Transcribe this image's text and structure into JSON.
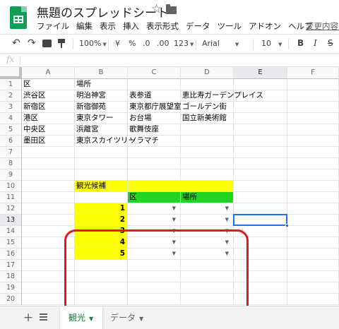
{
  "app": {
    "title": "無題のスプレッドシート",
    "star_icon": "star-icon",
    "folder_icon": "folder-icon",
    "last_edit": "変更内容を"
  },
  "menu": [
    "ファイル",
    "編集",
    "表示",
    "挿入",
    "表示形式",
    "データ",
    "ツール",
    "アドオン",
    "ヘルプ"
  ],
  "toolbar": {
    "zoom": "100%",
    "currency": "¥",
    "percent": "%",
    "decimal_decrease": ".0",
    "decimal_increase": ".00",
    "more_formats": "123",
    "font": "Arial",
    "font_size": "10",
    "bold": "B",
    "italic": "I",
    "strikethrough": "S"
  },
  "formula_bar": {
    "label": "fx"
  },
  "columns": [
    "A",
    "B",
    "C",
    "D",
    "E",
    "F"
  ],
  "rows": [
    "1",
    "2",
    "3",
    "4",
    "5",
    "6",
    "7",
    "8",
    "9",
    "10",
    "11",
    "12",
    "13",
    "14",
    "15",
    "16",
    "17",
    "18",
    "19",
    "20"
  ],
  "cells": {
    "A1": "区",
    "B1": "場所",
    "A2": "渋谷区",
    "B2": "明治神宮",
    "C2": "表参道",
    "D2": "恵比寿ガーデンプレイス",
    "A3": "新宿区",
    "B3": "新宿御苑",
    "C3": "東京都庁展望室",
    "D3": "ゴールデン街",
    "A4": "港区",
    "B4": "東京タワー",
    "C4": "お台場",
    "D4": "国立新美術館",
    "A5": "中央区",
    "B5": "浜離宮",
    "C5": "歌舞伎座",
    "A6": "墨田区",
    "B6": "東京スカイツリー",
    "C6": "ソラマチ",
    "B10": "観光候補",
    "C11": "区",
    "D11": "場所",
    "B12": "1",
    "B13": "2",
    "B14": "3",
    "B15": "4",
    "B16": "5"
  },
  "colors": {
    "yellow_fill": "#ffff00",
    "green_fill": "#21d521",
    "annotation": "#e0191b",
    "selection": "#1a73e8",
    "active_tab": "#188038"
  },
  "selected_cell": "E13",
  "sheets": {
    "add_icon": "plus-icon",
    "list_icon": "all-sheets-icon",
    "tabs": [
      {
        "label": "観光",
        "active": true
      },
      {
        "label": "データ",
        "active": false
      }
    ]
  }
}
